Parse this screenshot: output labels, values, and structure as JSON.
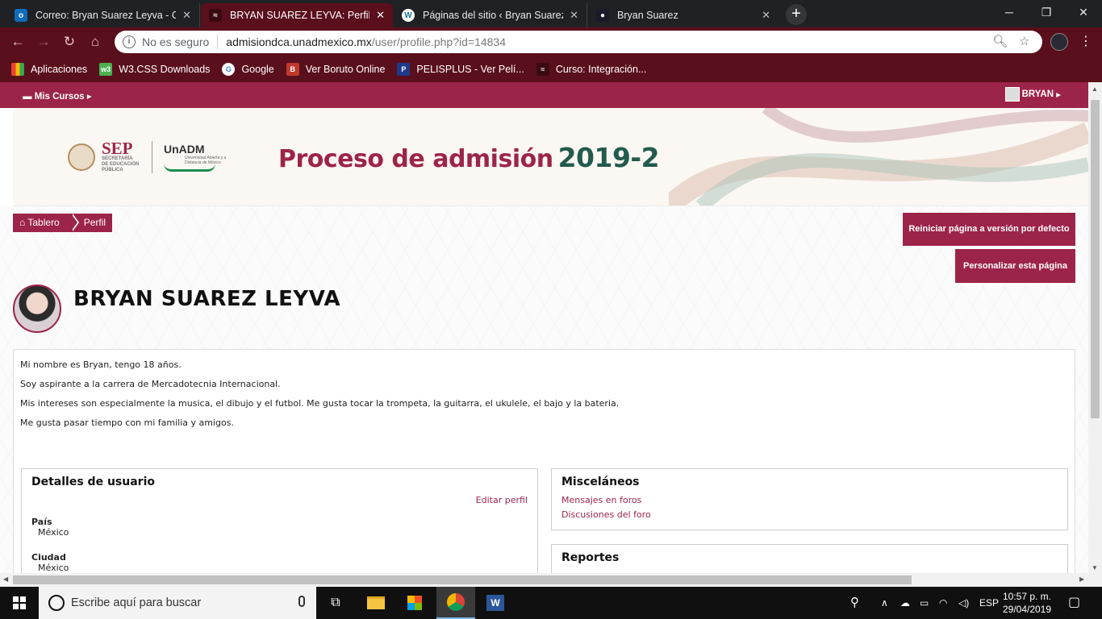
{
  "browser": {
    "tabs": [
      {
        "title": "Correo: Bryan Suarez Leyva - Out",
        "favicon": "outlook-icon",
        "active": false
      },
      {
        "title": "BRYAN SUAREZ LEYVA: Perfil púb",
        "favicon": "unadm-icon",
        "active": true
      },
      {
        "title": "Páginas del sitio ‹ Bryan Suarez –",
        "favicon": "wordpress-icon",
        "active": false
      },
      {
        "title": "Bryan Suarez",
        "favicon": "avatar-icon",
        "active": false
      }
    ],
    "security_label": "No es seguro",
    "url_domain": "admisiondca.unadmexico.mx",
    "url_path": "/user/profile.php?id=14834",
    "bookmarks": [
      {
        "label": "Aplicaciones",
        "icon": "apps-grid-icon"
      },
      {
        "label": "W3.CSS Downloads",
        "icon": "w3-icon"
      },
      {
        "label": "Google",
        "icon": "google-icon"
      },
      {
        "label": "Ver Boruto Online",
        "icon": "boruto-icon"
      },
      {
        "label": "PELISPLUS - Ver Pelí...",
        "icon": "pelisplus-icon"
      },
      {
        "label": "Curso: Integración...",
        "icon": "unadm-icon"
      }
    ]
  },
  "site": {
    "nav": {
      "courses": "Mis Cursos",
      "user": "BRYAN"
    },
    "banner": {
      "sep": "SEP",
      "sep_sub": "SECRETARÍA DE EDUCACIÓN PÚBLICA",
      "unadm": "UnADM",
      "unadm_sub": "Universidad Abierta y a Distancia de México",
      "title": "Proceso de admisión",
      "year": "2019-2"
    },
    "breadcrumb": {
      "home": "Tablero",
      "current": "Perfil"
    },
    "buttons": {
      "reset": "Reiniciar página a versión por defecto",
      "customize": "Personalizar esta página"
    },
    "profile_name": "BRYAN SUAREZ LEYVA",
    "description": [
      "Mi nombre es Bryan, tengo 18 años.",
      "Soy aspirante a la carrera de Mercadotecnia Internacional.",
      "Mis intereses son especialmente la musica, el dibujo y el futbol. Me gusta tocar la trompeta, la guitarra, el ukulele, el bajo y la bateria.",
      "Me gusta pasar tiempo con mi familia y amigos."
    ],
    "user_details": {
      "title": "Detalles de usuario",
      "edit": "Editar perfil",
      "country_label": "País",
      "country_value": "México",
      "city_label": "Ciudad",
      "city_value": "México"
    },
    "misc": {
      "title": "Misceláneos",
      "links": [
        "Mensajes en foros",
        "Discusiones del foro"
      ]
    },
    "reports": {
      "title": "Reportes"
    }
  },
  "taskbar": {
    "search_placeholder": "Escribe aquí para buscar",
    "language": "ESP",
    "time": "10:57 p. m.",
    "date": "29/04/2019"
  },
  "colors": {
    "brand": "#9d2449",
    "brand_dark": "#5a0f1c",
    "green": "#235b4e"
  }
}
